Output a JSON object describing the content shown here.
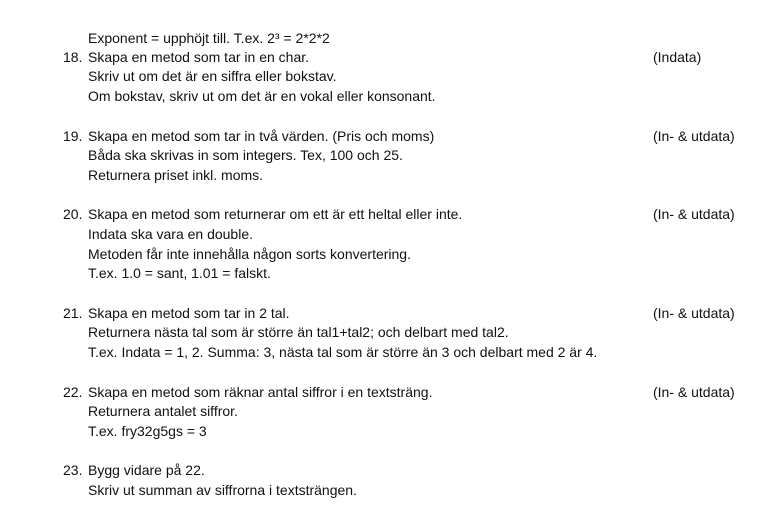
{
  "intro": {
    "text": "Exponent = upphöjt till. T.ex. 2³ = 2*2*2"
  },
  "exercises": [
    {
      "number": "18.",
      "title": "Skapa en metod som tar in en char.",
      "tag": "(Indata)",
      "lines": [
        "Skriv ut om det är en siffra eller bokstav.",
        "Om bokstav, skriv ut om det är en vokal eller konsonant."
      ]
    },
    {
      "number": "19.",
      "title": "Skapa en metod som tar in två värden. (Pris och moms)",
      "tag": "(In- & utdata)",
      "lines": [
        "Båda ska skrivas in som integers. Tex, 100 och 25.",
        "Returnera priset inkl. moms."
      ]
    },
    {
      "number": "20.",
      "title": "Skapa en metod som returnerar om ett är ett heltal eller inte.",
      "tag": "(In- & utdata)",
      "lines": [
        "Indata ska vara en double.",
        "Metoden får inte innehålla någon sorts konvertering.",
        "T.ex. 1.0 = sant, 1.01 = falskt."
      ]
    },
    {
      "number": "21.",
      "title": "Skapa en metod som tar in 2 tal.",
      "tag": "(In- & utdata)",
      "lines": [
        "Returnera nästa tal som är större än tal1+tal2; och delbart med tal2.",
        "T.ex. Indata = 1, 2. Summa: 3, nästa tal som är större än 3 och delbart med 2 är 4."
      ]
    },
    {
      "number": "22.",
      "title": "Skapa en metod som räknar antal siffror i en textsträng.",
      "tag": "(In- & utdata)",
      "lines": [
        "Returnera antalet siffror.",
        "T.ex. fry32g5gs = 3"
      ]
    },
    {
      "number": "23.",
      "title": "Bygg vidare på 22.",
      "tag": "",
      "lines": [
        "Skriv ut summan av siffrorna i textsträngen."
      ]
    }
  ]
}
